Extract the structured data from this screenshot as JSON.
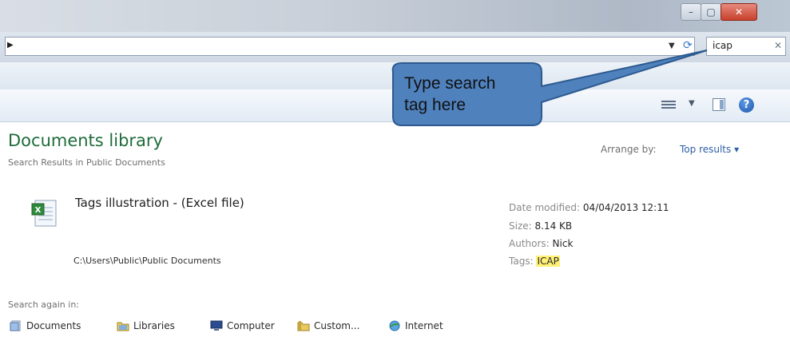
{
  "window": {
    "controls": {
      "minimize": "–",
      "maximize": "▢",
      "close": "✕"
    }
  },
  "address_bar": {
    "search_value": "icap",
    "search_clear": "✕"
  },
  "callout": {
    "line1": "Type search",
    "line2": "tag here",
    "fill": "#4f81bd"
  },
  "library": {
    "title": "Documents library",
    "subtitle": "Search Results in Public Documents",
    "arrange_label": "Arrange by:",
    "arrange_value": "Top results ▾"
  },
  "result": {
    "name": "Tags illustration - (Excel file)",
    "path": "C:\\Users\\Public\\Public Documents",
    "date_label": "Date modified:",
    "date_value": "04/04/2013 12:11",
    "size_label": "Size:",
    "size_value": "8.14 KB",
    "authors_label": "Authors:",
    "authors_value": "Nick",
    "tags_label": "Tags:",
    "tags_value": "ICAP"
  },
  "search_again": {
    "label": "Search again in:",
    "locations": [
      {
        "label": "Documents",
        "icon": "documents-icon"
      },
      {
        "label": "Libraries",
        "icon": "libraries-icon"
      },
      {
        "label": "Computer",
        "icon": "computer-icon"
      },
      {
        "label": "Custom...",
        "icon": "custom-icon"
      },
      {
        "label": "Internet",
        "icon": "internet-icon"
      }
    ]
  },
  "colors": {
    "title_green": "#1e6c3a",
    "link_blue": "#2d5fa8",
    "tag_highlight": "#fff176"
  }
}
